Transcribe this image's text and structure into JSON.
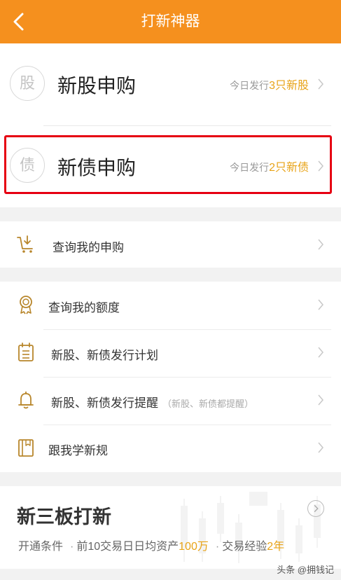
{
  "header": {
    "title": "打新神器"
  },
  "subscribe": [
    {
      "icon_char": "股",
      "label": "新股申购",
      "info_prefix": "今日发行",
      "info_count": "3只新股"
    },
    {
      "icon_char": "债",
      "label": "新债申购",
      "info_prefix": "今日发行",
      "info_count": "2只新债"
    }
  ],
  "query_subscribe": {
    "label": "查询我的申购"
  },
  "menu": [
    {
      "label": "查询我的额度"
    },
    {
      "label": "新股、新债发行计划"
    },
    {
      "label": "新股、新债发行提醒",
      "note": "（新股、新债都提醒）"
    },
    {
      "label": "跟我学新规"
    }
  ],
  "neeq": {
    "title": "新三板打新",
    "cond_label": "开通条件",
    "cond1_prefix": "前10交易日日均资产",
    "cond1_value": "100万",
    "cond2_prefix": "交易经验",
    "cond2_value": "2年"
  },
  "watermark": "头条 @拥钱记",
  "colors": {
    "accent": "#f5901e",
    "highlight": "#e60012",
    "number": "#e8a317"
  }
}
